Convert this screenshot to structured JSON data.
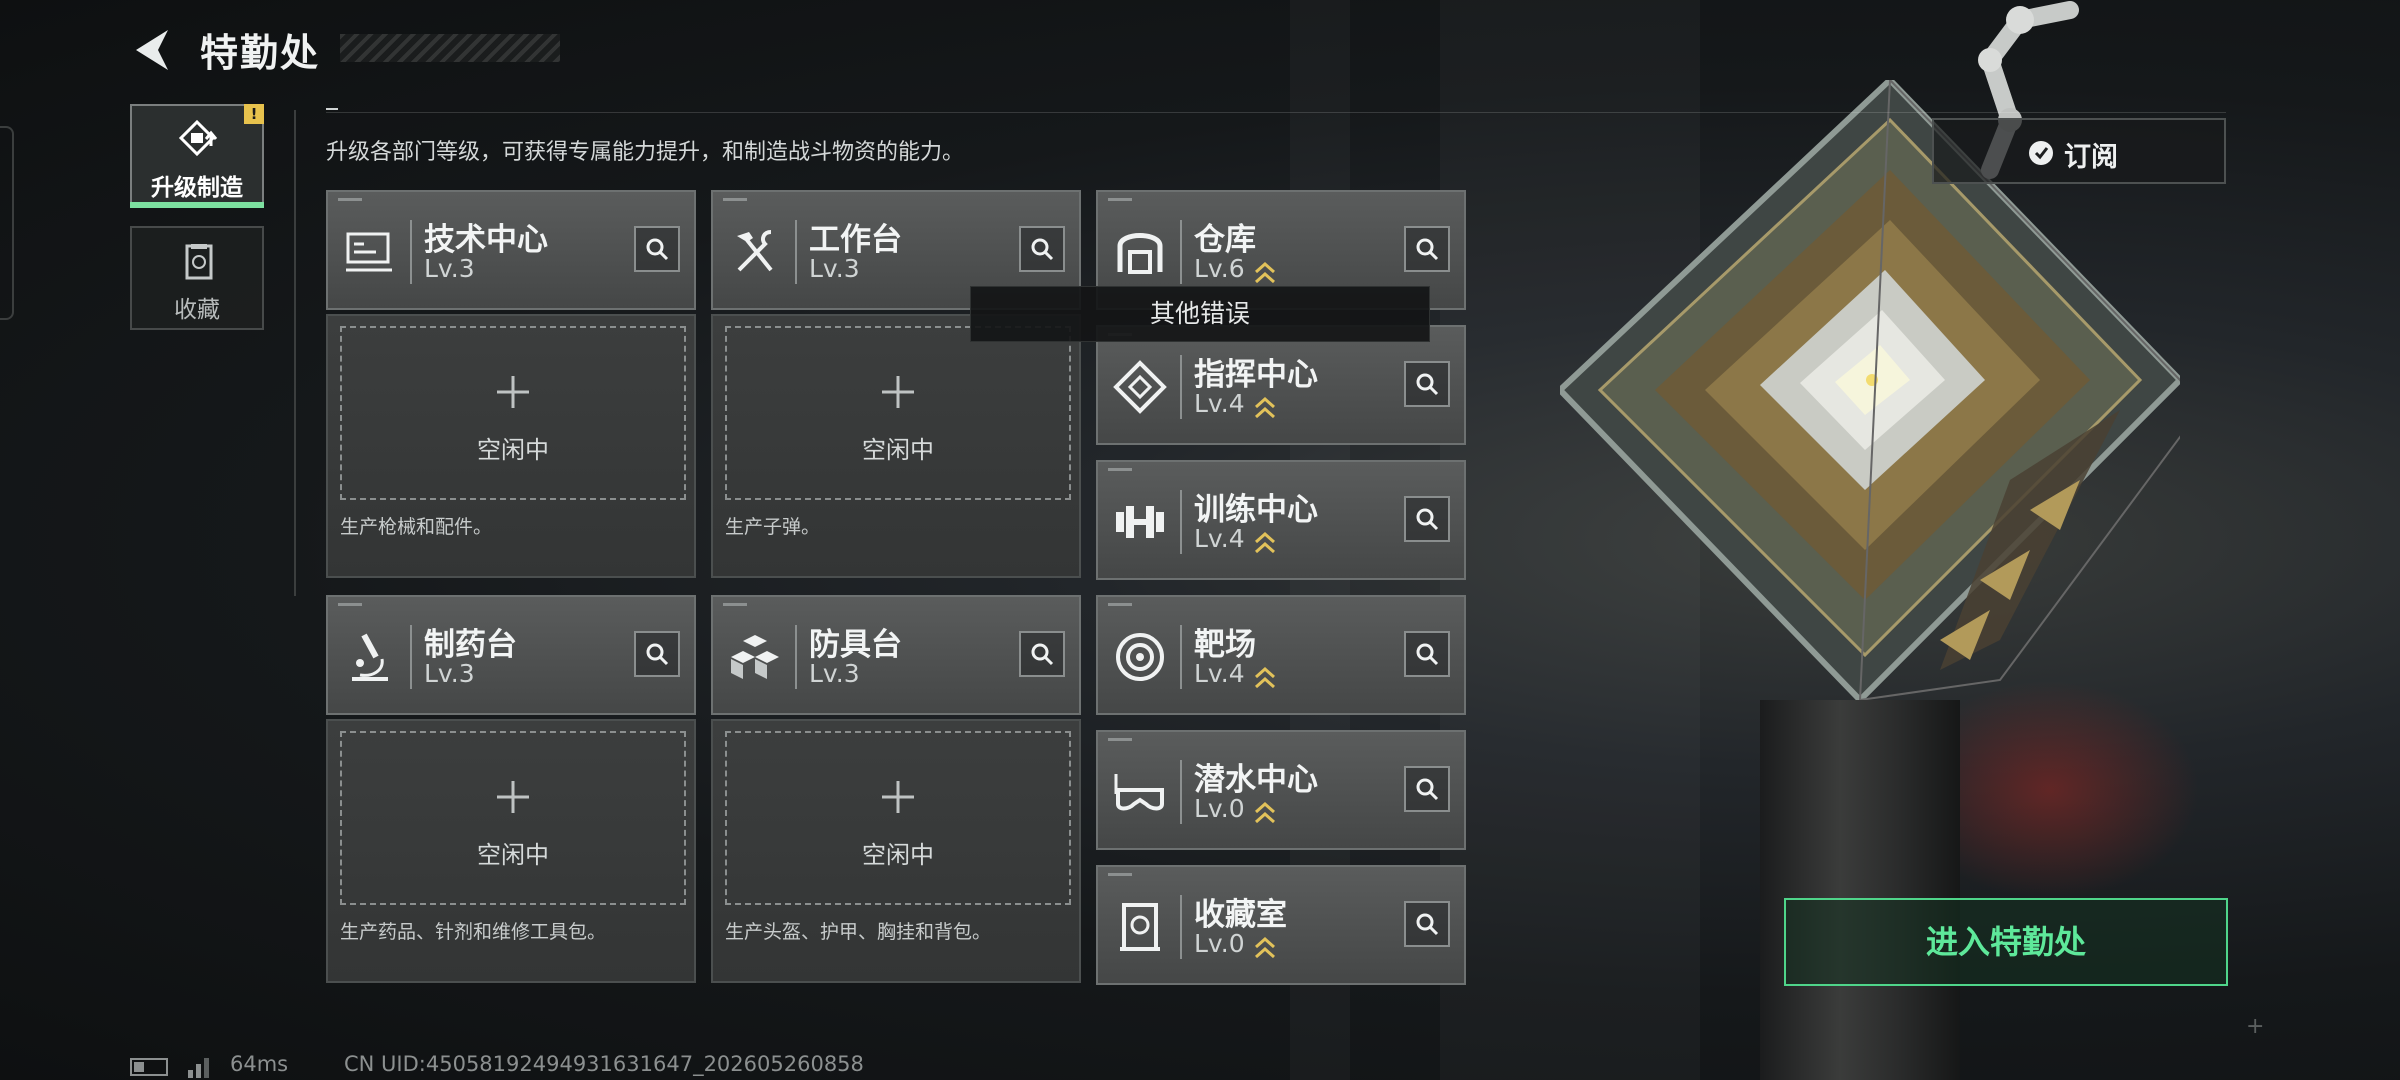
{
  "header": {
    "title": "特勤处"
  },
  "sidebar": {
    "tabs": [
      {
        "label": "升级制造",
        "active": true,
        "alert": "!"
      },
      {
        "label": "收藏",
        "active": false
      }
    ]
  },
  "description": "升级各部门等级，可获得专属能力提升，和制造战斗物资的能力。",
  "subscribe": {
    "label": "订阅"
  },
  "buildings": [
    {
      "name": "技术中心",
      "level": "Lv.3",
      "icon": "monitor-icon",
      "idle_label": "空闲中",
      "note": "生产枪械和配件。"
    },
    {
      "name": "工作台",
      "level": "Lv.3",
      "icon": "hammer-wrench-icon",
      "idle_label": "空闲中",
      "note": "生产子弹。"
    },
    {
      "name": "制药台",
      "level": "Lv.3",
      "icon": "microscope-icon",
      "idle_label": "空闲中",
      "note": "生产药品、针剂和维修工具包。"
    },
    {
      "name": "防具台",
      "level": "Lv.3",
      "icon": "cubes-icon",
      "idle_label": "空闲中",
      "note": "生产头盔、护甲、胸挂和背包。"
    }
  ],
  "facilities": [
    {
      "name": "仓库",
      "level": "Lv.6",
      "icon": "warehouse-icon"
    },
    {
      "name": "指挥中心",
      "level": "Lv.4",
      "icon": "diamond-target-icon"
    },
    {
      "name": "训练中心",
      "level": "Lv.4",
      "icon": "dumbbell-icon"
    },
    {
      "name": "靶场",
      "level": "Lv.4",
      "icon": "target-icon"
    },
    {
      "name": "潜水中心",
      "level": "Lv.0",
      "icon": "dive-mask-icon"
    },
    {
      "name": "收藏室",
      "level": "Lv.0",
      "icon": "collection-icon"
    }
  ],
  "tooltip": "其他错误",
  "enter_button": "进入特勤处",
  "footer": {
    "ping": "64ms",
    "uid": "CN UID:450581924949316316​47_202605260858"
  },
  "colors": {
    "accent_green": "#5ee89a",
    "alert_yellow": "#e7c24d",
    "upgrade_chevron": "#e2c25a"
  }
}
